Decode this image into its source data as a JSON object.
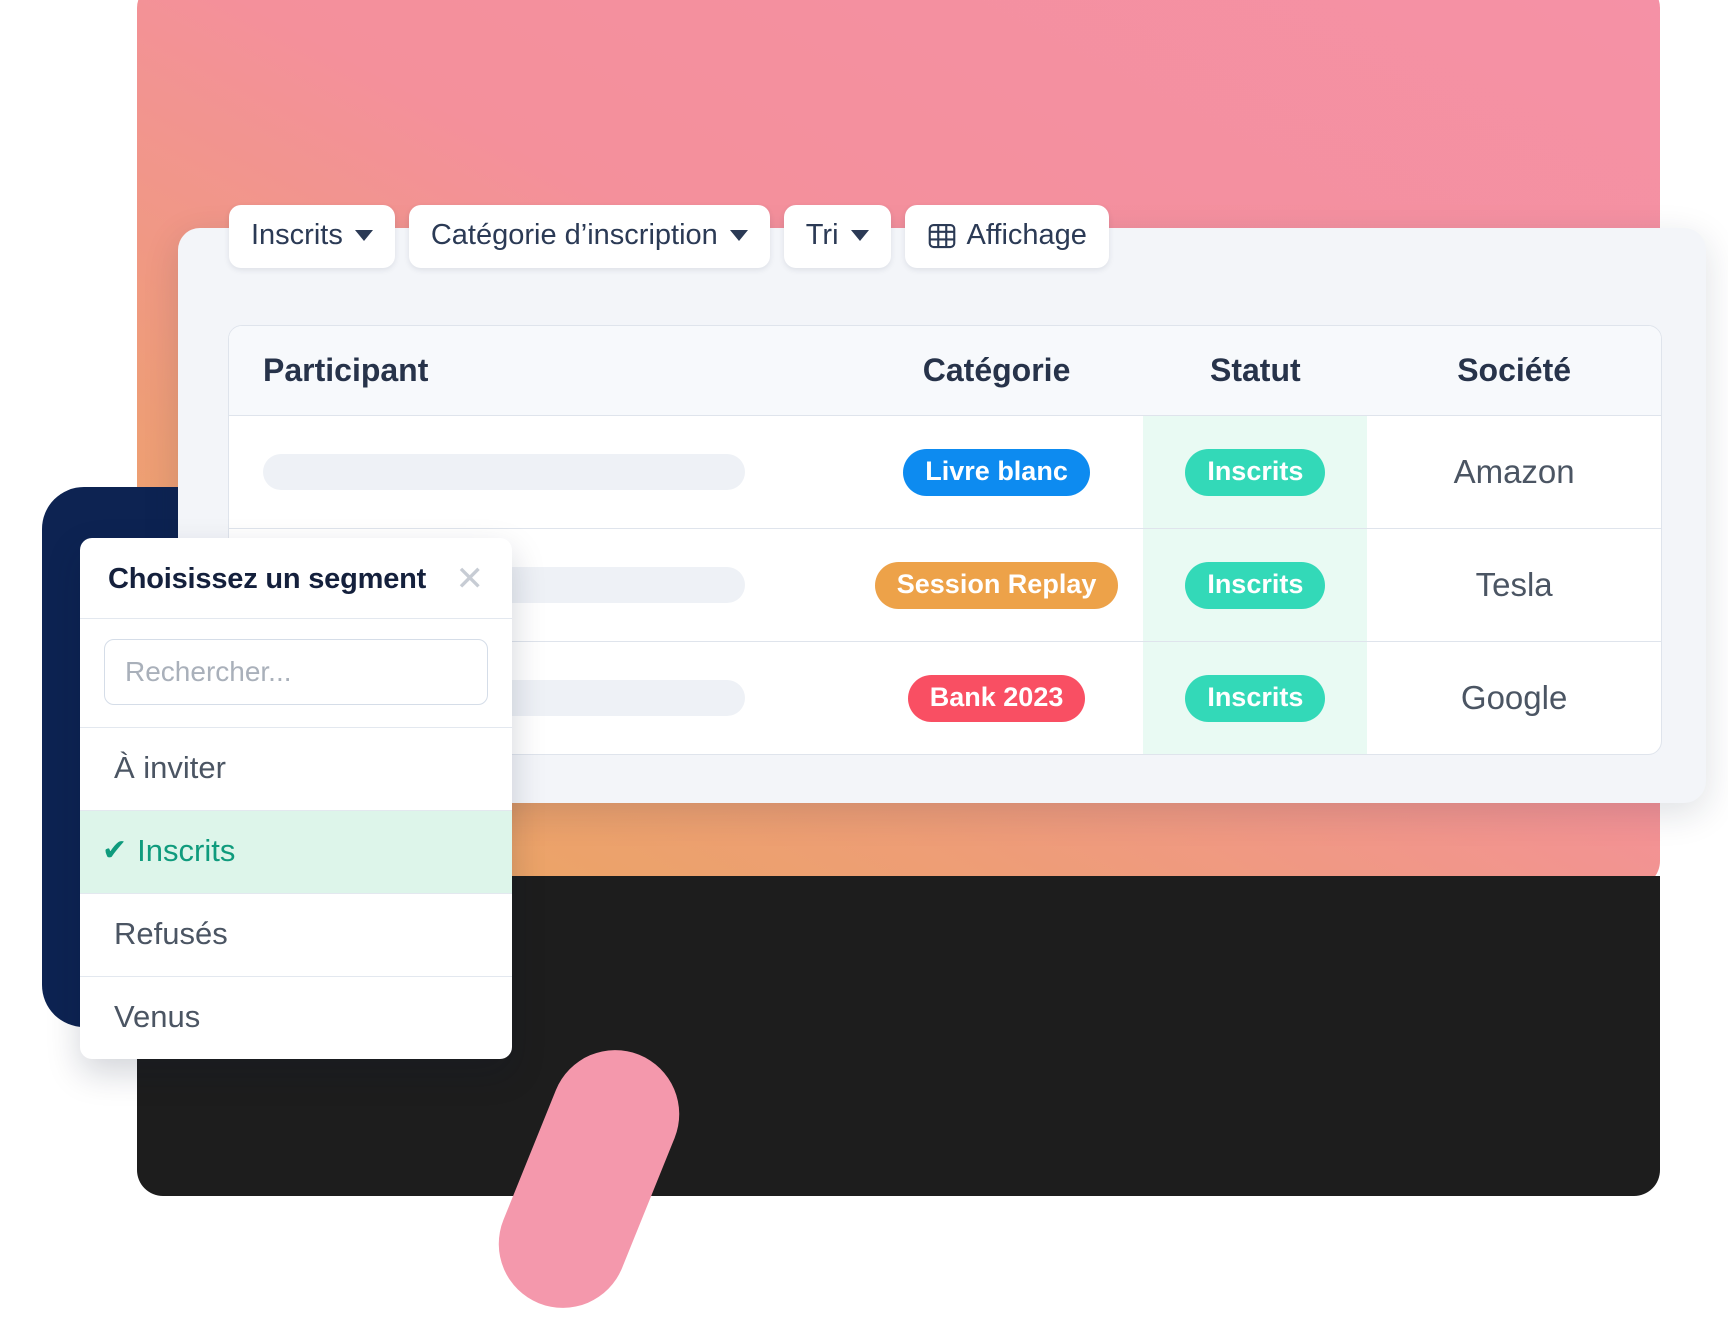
{
  "decor": {
    "gradient_from": "#e9a95b",
    "gradient_to": "#f591a6",
    "dark_card_color": "#1d1d1d",
    "navy_card_color": "#0d2352",
    "pink_pill_color": "#f498ac"
  },
  "toolbar": {
    "filters": [
      {
        "label": "Inscrits",
        "icon": "chevron-down-icon",
        "has_caret": true,
        "leading_icon": null
      },
      {
        "label": "Catégorie d’inscription",
        "icon": "chevron-down-icon",
        "has_caret": true,
        "leading_icon": null
      },
      {
        "label": "Tri",
        "icon": "chevron-down-icon",
        "has_caret": true,
        "leading_icon": null
      },
      {
        "label": "Affichage",
        "icon": null,
        "has_caret": false,
        "leading_icon": "table-grid-icon"
      }
    ]
  },
  "table": {
    "columns": [
      "Participant",
      "Catégorie",
      "Statut",
      "Société"
    ],
    "rows": [
      {
        "participant": "",
        "participant_placeholder": true,
        "categorie": "Livre blanc",
        "categorie_color": "#0d8bf0",
        "statut": "Inscrits",
        "statut_color": "#33d9b8",
        "societe": "Amazon"
      },
      {
        "participant": "",
        "participant_placeholder": true,
        "categorie": "Session Replay",
        "categorie_color": "#eda249",
        "statut": "Inscrits",
        "statut_color": "#33d9b8",
        "societe": "Tesla"
      },
      {
        "participant": "",
        "participant_placeholder": true,
        "categorie": "Bank 2023",
        "categorie_color": "#f94f63",
        "statut": "Inscrits",
        "statut_color": "#33d9b8",
        "societe": "Google"
      }
    ]
  },
  "segment_panel": {
    "title": "Choisissez un segment",
    "close_label": "✕",
    "search": {
      "value": "",
      "placeholder": "Rechercher..."
    },
    "items": [
      {
        "label": "À inviter",
        "selected": false
      },
      {
        "label": "Inscrits",
        "selected": true
      },
      {
        "label": "Refusés",
        "selected": false
      },
      {
        "label": "Venus",
        "selected": false
      }
    ],
    "check_glyph": "✔",
    "selected_color": "#0f9b7d",
    "selected_bg": "#ddf5ea"
  }
}
